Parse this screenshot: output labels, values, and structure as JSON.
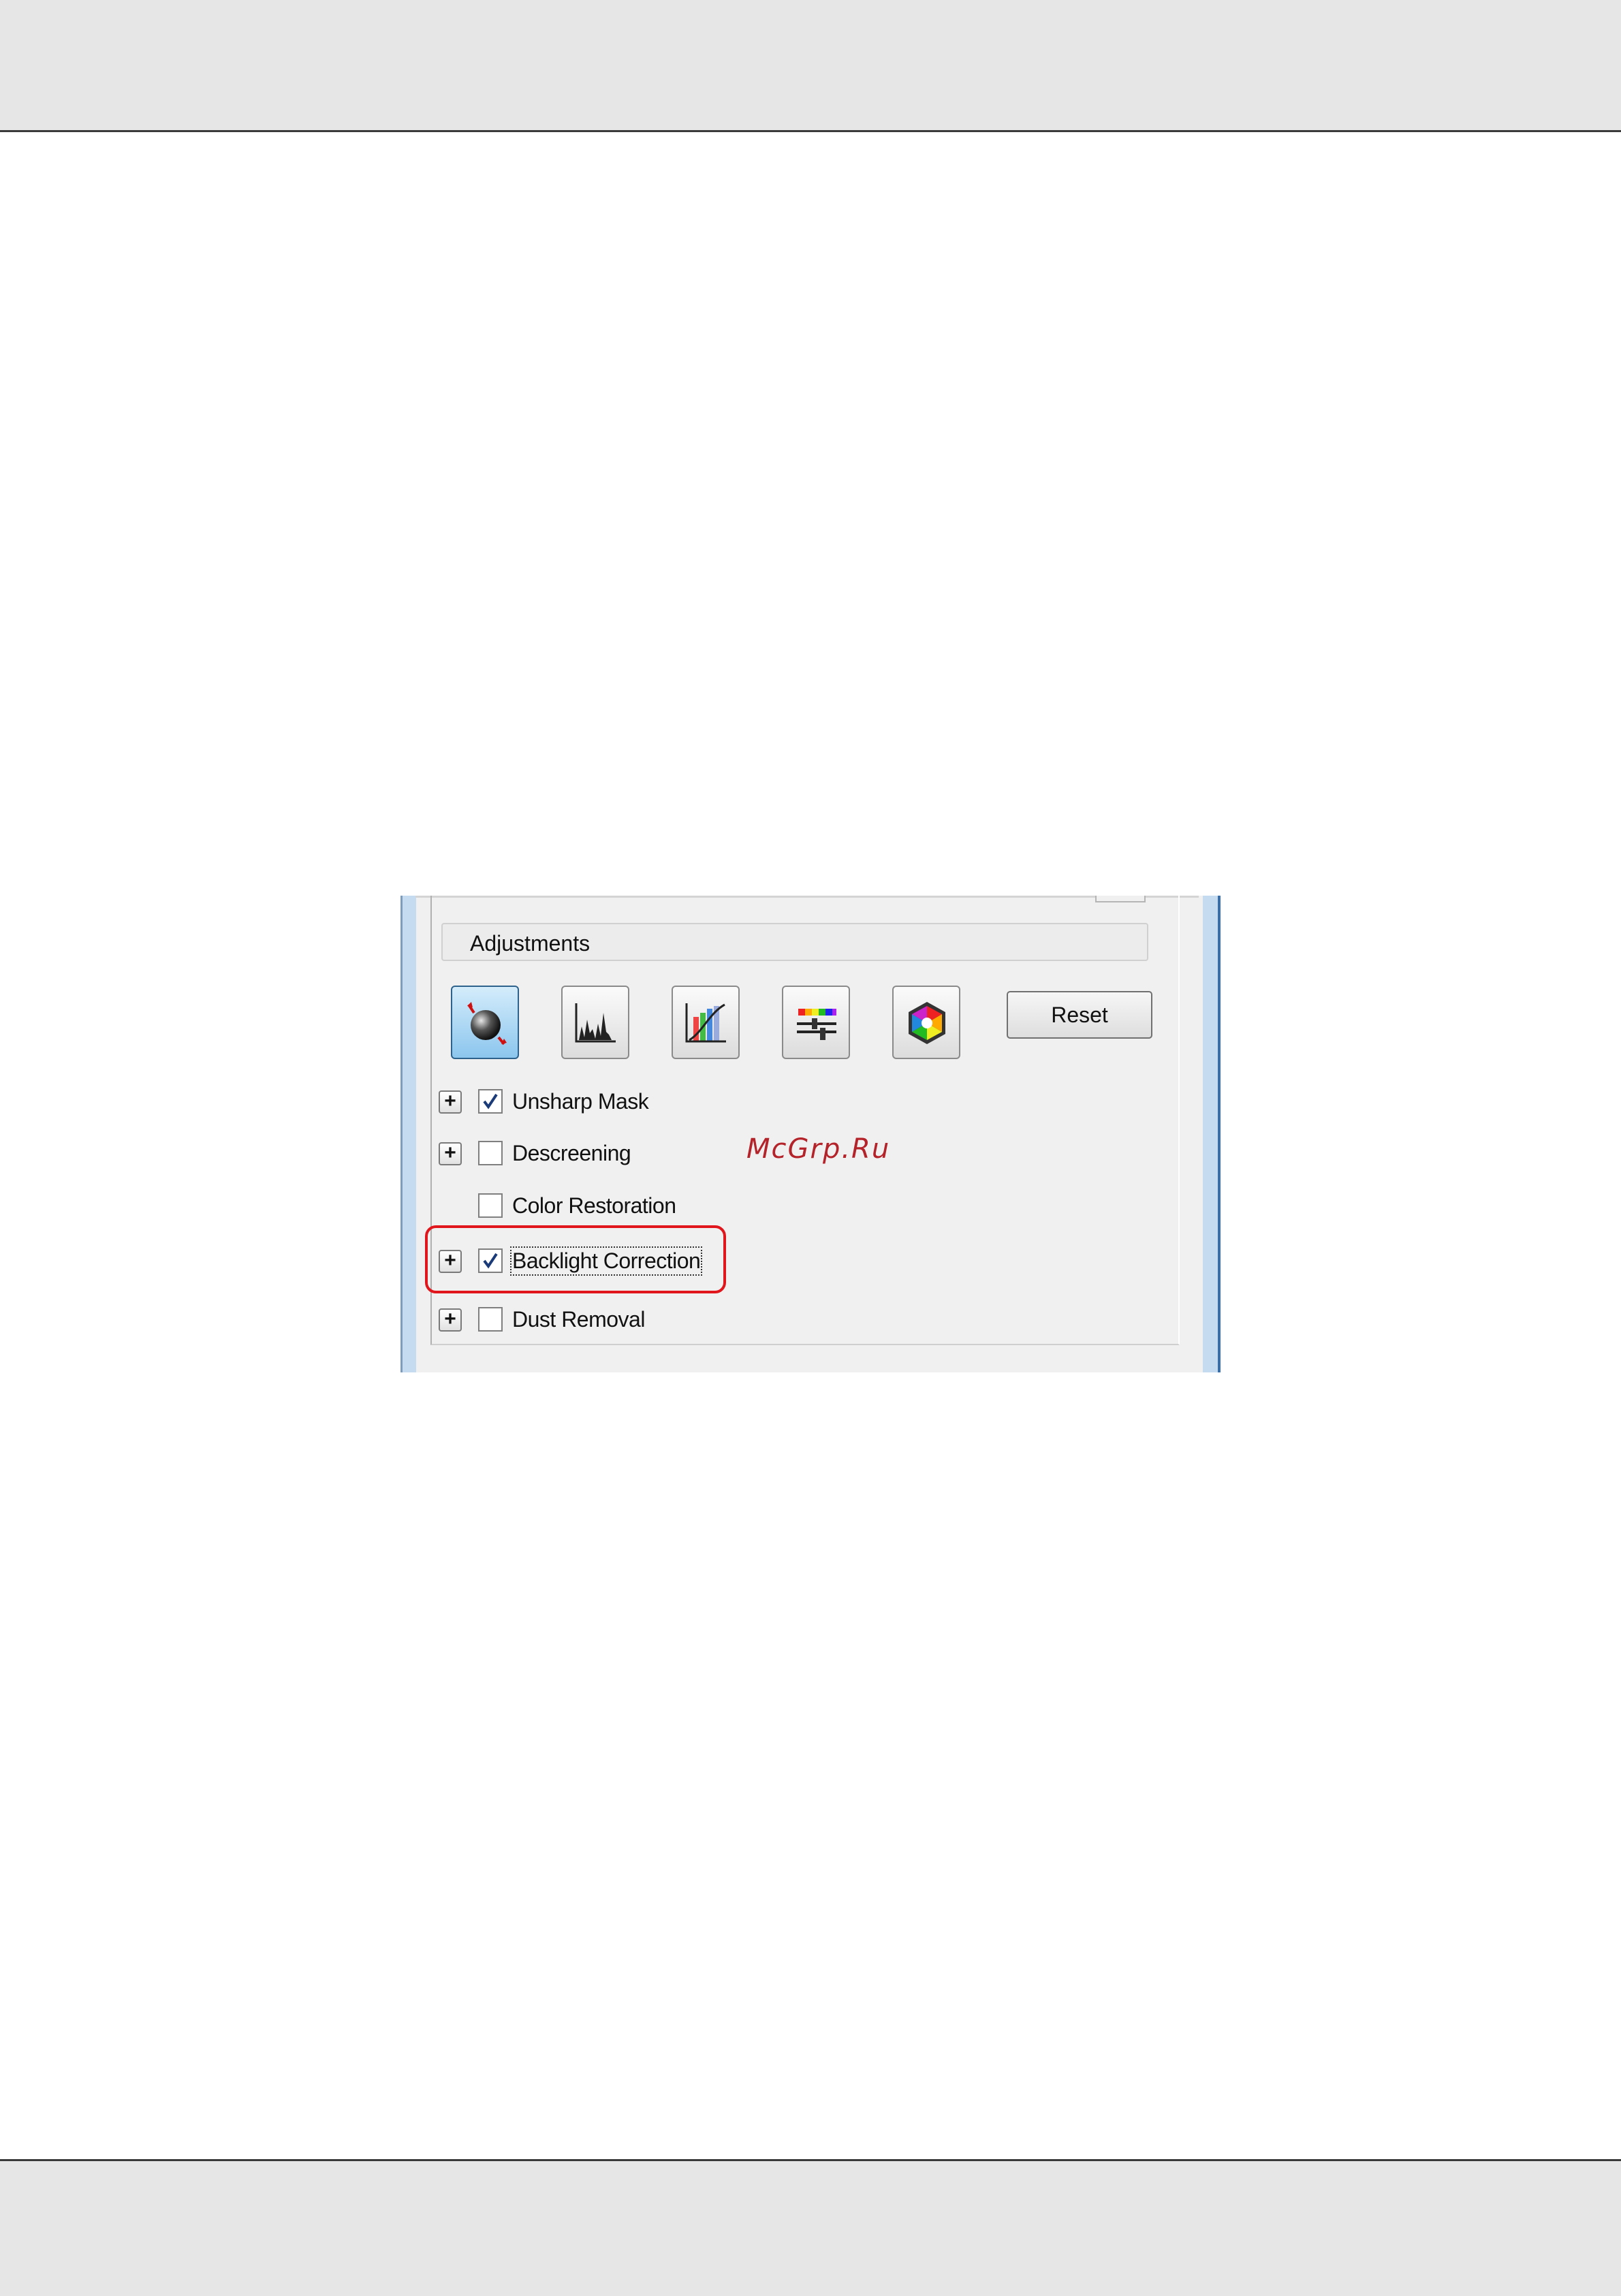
{
  "panel": {
    "section_title": "Adjustments",
    "tool_buttons": [
      {
        "icon": "auto-exposure-icon",
        "active": true
      },
      {
        "icon": "histogram-icon",
        "active": false
      },
      {
        "icon": "tone-curve-icon",
        "active": false
      },
      {
        "icon": "image-adjustment-icon",
        "active": false
      },
      {
        "icon": "color-palette-icon",
        "active": false
      }
    ],
    "reset_label": "Reset",
    "options": [
      {
        "label": "Unsharp Mask",
        "checked": true,
        "expandable": true
      },
      {
        "label": "Descreening",
        "checked": false,
        "expandable": true
      },
      {
        "label": "Color Restoration",
        "checked": false,
        "expandable": false
      },
      {
        "label": "Backlight Correction",
        "checked": true,
        "expandable": true,
        "highlighted": true
      },
      {
        "label": "Dust Removal",
        "checked": false,
        "expandable": true
      }
    ],
    "expander_glyph": "+"
  },
  "watermark": "McGrp.Ru",
  "colors": {
    "highlight": "#e0161c",
    "active_button": "#8cc6ee",
    "watermark": "#b5232a"
  }
}
